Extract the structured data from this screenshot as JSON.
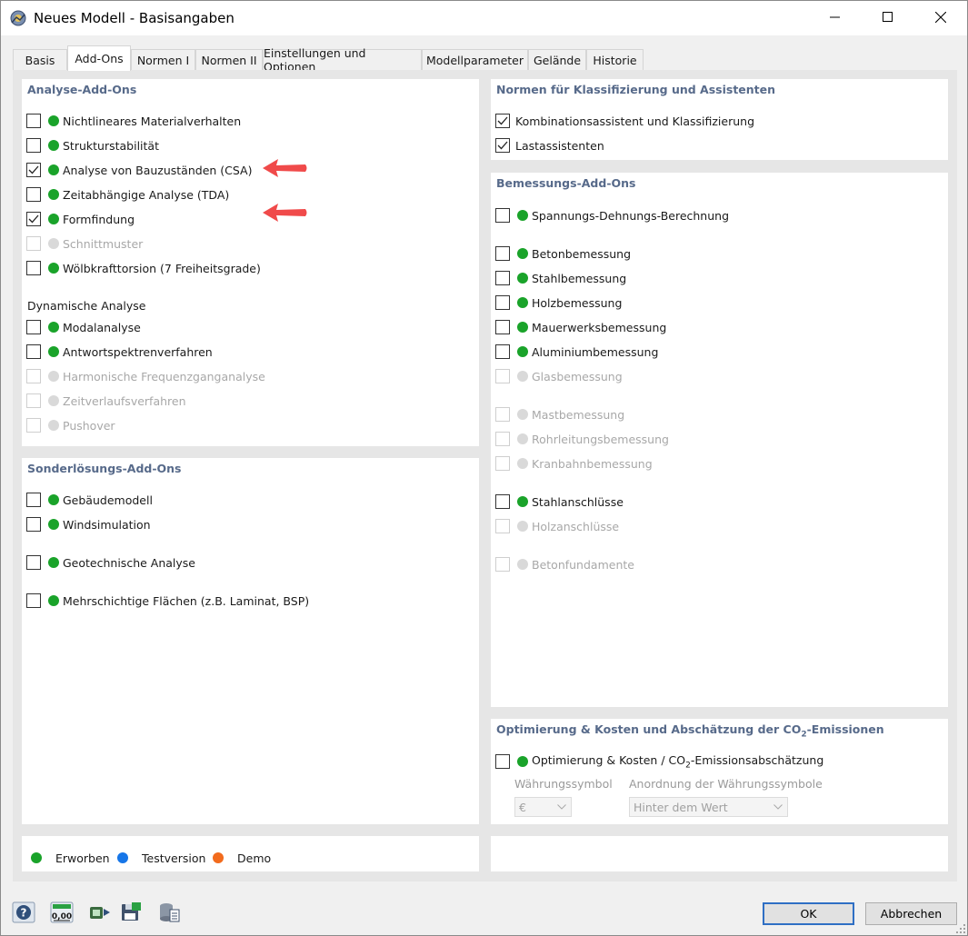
{
  "window": {
    "title": "Neues Modell - Basisangaben"
  },
  "tabs": [
    {
      "label": "Basis"
    },
    {
      "label": "Add-Ons"
    },
    {
      "label": "Normen I"
    },
    {
      "label": "Normen II"
    },
    {
      "label": "Einstellungen und Optionen"
    },
    {
      "label": "Modellparameter"
    },
    {
      "label": "Gelände"
    },
    {
      "label": "Historie"
    }
  ],
  "active_tab": "Add-Ons",
  "analysis": {
    "title": "Analyse-Add-Ons",
    "items": [
      {
        "label": "Nichtlineares Materialverhalten",
        "checked": false,
        "enabled": true,
        "license": "green"
      },
      {
        "label": "Strukturstabilität",
        "checked": false,
        "enabled": true,
        "license": "green"
      },
      {
        "label": "Analyse von Bauzuständen (CSA)",
        "checked": true,
        "enabled": true,
        "license": "green"
      },
      {
        "label": "Zeitabhängige Analyse (TDA)",
        "checked": false,
        "enabled": true,
        "license": "green"
      },
      {
        "label": "Formfindung",
        "checked": true,
        "enabled": true,
        "license": "green"
      },
      {
        "label": "Schnittmuster",
        "checked": false,
        "enabled": false,
        "license": "gray"
      },
      {
        "label": "Wölbkrafttorsion (7 Freiheitsgrade)",
        "checked": false,
        "enabled": true,
        "license": "green"
      }
    ],
    "dynamic_title": "Dynamische Analyse",
    "dynamic_items": [
      {
        "label": "Modalanalyse",
        "checked": false,
        "enabled": true,
        "license": "green"
      },
      {
        "label": "Antwortspektrenverfahren",
        "checked": false,
        "enabled": true,
        "license": "green"
      },
      {
        "label": "Harmonische Frequenzganganalyse",
        "checked": false,
        "enabled": false,
        "license": "gray"
      },
      {
        "label": "Zeitverlaufsverfahren",
        "checked": false,
        "enabled": false,
        "license": "gray"
      },
      {
        "label": "Pushover",
        "checked": false,
        "enabled": false,
        "license": "gray"
      }
    ]
  },
  "special": {
    "title": "Sonderlösungs-Add-Ons",
    "items": [
      {
        "label": "Gebäudemodell",
        "checked": false,
        "enabled": true,
        "license": "green"
      },
      {
        "label": "Windsimulation",
        "checked": false,
        "enabled": true,
        "license": "green"
      },
      {
        "label": "Geotechnische Analyse",
        "checked": false,
        "enabled": true,
        "license": "green"
      },
      {
        "label": "Mehrschichtige Flächen (z.B. Laminat, BSP)",
        "checked": false,
        "enabled": true,
        "license": "green"
      }
    ]
  },
  "legend": {
    "purchased": "Erworben",
    "trial": "Testversion",
    "demo": "Demo"
  },
  "standards": {
    "title": "Normen für Klassifizierung und Assistenten",
    "items": [
      {
        "label": "Kombinationsassistent und Klassifizierung",
        "checked": true,
        "enabled": true
      },
      {
        "label": "Lastassistenten",
        "checked": true,
        "enabled": true
      }
    ]
  },
  "design": {
    "title": "Bemessungs-Add-Ons",
    "items": [
      {
        "label": "Spannungs-Dehnungs-Berechnung",
        "checked": false,
        "enabled": true,
        "license": "green"
      },
      {
        "label": "Betonbemessung",
        "checked": false,
        "enabled": true,
        "license": "green"
      },
      {
        "label": "Stahlbemessung",
        "checked": false,
        "enabled": true,
        "license": "green"
      },
      {
        "label": "Holzbemessung",
        "checked": false,
        "enabled": true,
        "license": "green"
      },
      {
        "label": "Mauerwerksbemessung",
        "checked": false,
        "enabled": true,
        "license": "green"
      },
      {
        "label": "Aluminiumbemessung",
        "checked": false,
        "enabled": true,
        "license": "green"
      },
      {
        "label": "Glasbemessung",
        "checked": false,
        "enabled": false,
        "license": "gray"
      },
      {
        "label": "Mastbemessung",
        "checked": false,
        "enabled": false,
        "license": "gray"
      },
      {
        "label": "Rohrleitungsbemessung",
        "checked": false,
        "enabled": false,
        "license": "gray"
      },
      {
        "label": "Kranbahnbemessung",
        "checked": false,
        "enabled": false,
        "license": "gray"
      },
      {
        "label": "Stahlanschlüsse",
        "checked": false,
        "enabled": true,
        "license": "green"
      },
      {
        "label": "Holzanschlüsse",
        "checked": false,
        "enabled": false,
        "license": "gray"
      },
      {
        "label": "Betonfundamente",
        "checked": false,
        "enabled": false,
        "license": "gray"
      }
    ]
  },
  "optimization": {
    "title_pre": "Optimierung & Kosten und Abschätzung der CO",
    "title_sub": "2",
    "title_post": "-Emissionen",
    "item_pre": "Optimierung & Kosten / CO",
    "item_sub": "2",
    "item_post": "-Emissionsabschätzung",
    "item_checked": false,
    "currency_label": "Währungssymbol",
    "currency_value": "€",
    "position_label": "Anordnung der Währungssymbole",
    "position_value": "Hinter dem Wert"
  },
  "buttons": {
    "ok": "OK",
    "cancel": "Abbrechen"
  },
  "bottom_tools": [
    {
      "name": "help-icon"
    },
    {
      "name": "units-icon",
      "text": "0,00"
    },
    {
      "name": "export-icon"
    },
    {
      "name": "save-icon"
    },
    {
      "name": "database-icon"
    }
  ],
  "colors": {
    "purchased": "#1aa32a",
    "trial": "#1676e8",
    "demo": "#f26b1d",
    "unavailable": "#d9d9d9",
    "section_title": "#576a8a",
    "arrow": "#f04a4a"
  }
}
